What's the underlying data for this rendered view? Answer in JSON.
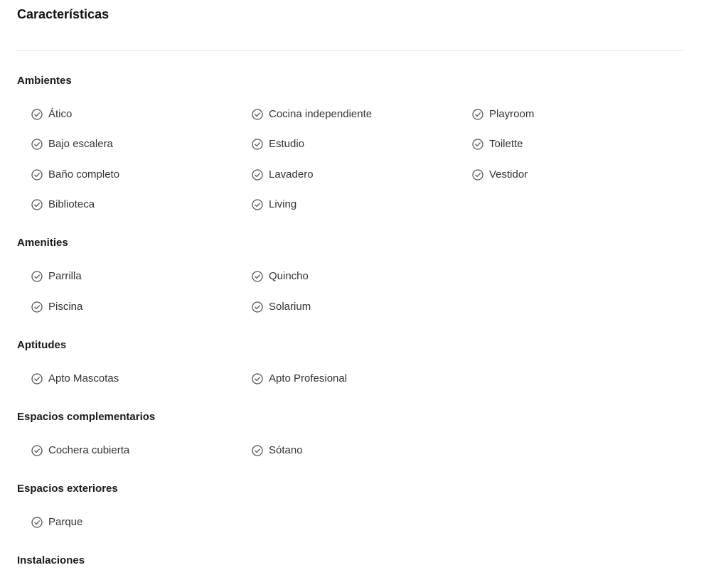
{
  "title": "Características",
  "sections": {
    "ambientes": {
      "title": "Ambientes",
      "items": [
        "Ático",
        "Cocina independiente",
        "Playroom",
        "Bajo escalera",
        "Estudio",
        "Toilette",
        "Baño completo",
        "Lavadero",
        "Vestidor",
        "Biblioteca",
        "Living"
      ]
    },
    "amenities": {
      "title": "Amenities",
      "items": [
        "Parrilla",
        "Quincho",
        "Piscina",
        "Solarium"
      ]
    },
    "aptitudes": {
      "title": "Aptitudes",
      "items": [
        "Apto Mascotas",
        "Apto Profesional"
      ]
    },
    "espacios_complementarios": {
      "title": "Espacios complementarios",
      "items": [
        "Cochera cubierta",
        "Sótano"
      ]
    },
    "espacios_exteriores": {
      "title": "Espacios exteriores",
      "items": [
        "Parque"
      ]
    },
    "instalaciones": {
      "title": "Instalaciones",
      "items": []
    }
  },
  "icon": "check-circle-icon",
  "colors": {
    "text": "#333333",
    "heading": "#1a1a1a",
    "icon": "#555555",
    "divider": "#e3e3e3"
  }
}
